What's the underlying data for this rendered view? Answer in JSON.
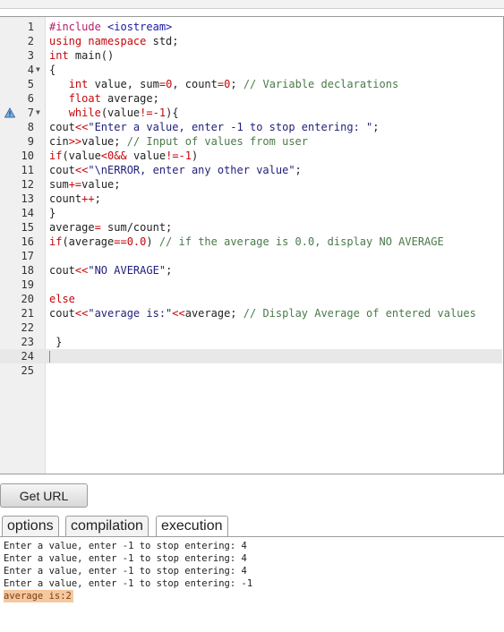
{
  "editor": {
    "lines": [
      {
        "n": "1",
        "tokens": [
          {
            "t": "#include ",
            "c": "pp"
          },
          {
            "t": "<iostream>",
            "c": "str-inc"
          }
        ]
      },
      {
        "n": "2",
        "tokens": [
          {
            "t": "using namespace ",
            "c": "kw"
          },
          {
            "t": "std;",
            "c": ""
          }
        ]
      },
      {
        "n": "3",
        "tokens": [
          {
            "t": "int ",
            "c": "ty"
          },
          {
            "t": "main()",
            "c": ""
          }
        ]
      },
      {
        "n": "4",
        "fold": true,
        "tokens": [
          {
            "t": "{",
            "c": ""
          }
        ]
      },
      {
        "n": "5",
        "tokens": [
          {
            "t": "   ",
            "c": ""
          },
          {
            "t": "int ",
            "c": "ty"
          },
          {
            "t": "value, sum",
            "c": ""
          },
          {
            "t": "=",
            "c": "op"
          },
          {
            "t": "0",
            "c": "num"
          },
          {
            "t": ", count",
            "c": ""
          },
          {
            "t": "=",
            "c": "op"
          },
          {
            "t": "0",
            "c": "num"
          },
          {
            "t": "; ",
            "c": ""
          },
          {
            "t": "// Variable declarations",
            "c": "cm"
          }
        ]
      },
      {
        "n": "6",
        "tokens": [
          {
            "t": "   ",
            "c": ""
          },
          {
            "t": "float ",
            "c": "ty"
          },
          {
            "t": "average;",
            "c": ""
          }
        ]
      },
      {
        "n": "7",
        "fold": true,
        "warn": true,
        "tokens": [
          {
            "t": "   ",
            "c": ""
          },
          {
            "t": "while",
            "c": "kw"
          },
          {
            "t": "(value",
            "c": ""
          },
          {
            "t": "!=-",
            "c": "op"
          },
          {
            "t": "1",
            "c": "num"
          },
          {
            "t": "){",
            "c": ""
          }
        ]
      },
      {
        "n": "8",
        "tokens": [
          {
            "t": "cout",
            "c": ""
          },
          {
            "t": "<<",
            "c": "op"
          },
          {
            "t": "\"Enter a value, enter -1 to stop entering: \"",
            "c": "str"
          },
          {
            "t": ";",
            "c": ""
          }
        ]
      },
      {
        "n": "9",
        "tokens": [
          {
            "t": "cin",
            "c": ""
          },
          {
            "t": ">>",
            "c": "op"
          },
          {
            "t": "value; ",
            "c": ""
          },
          {
            "t": "// Input of values from user",
            "c": "cm"
          }
        ]
      },
      {
        "n": "10",
        "tokens": [
          {
            "t": "if",
            "c": "kw"
          },
          {
            "t": "(value",
            "c": ""
          },
          {
            "t": "<",
            "c": "op"
          },
          {
            "t": "0",
            "c": "num"
          },
          {
            "t": "&&",
            "c": "op"
          },
          {
            "t": " value",
            "c": ""
          },
          {
            "t": "!=-",
            "c": "op"
          },
          {
            "t": "1",
            "c": "num"
          },
          {
            "t": ")",
            "c": ""
          }
        ]
      },
      {
        "n": "11",
        "tokens": [
          {
            "t": "cout",
            "c": ""
          },
          {
            "t": "<<",
            "c": "op"
          },
          {
            "t": "\"\\nERROR, enter any other value\"",
            "c": "str"
          },
          {
            "t": ";",
            "c": ""
          }
        ]
      },
      {
        "n": "12",
        "tokens": [
          {
            "t": "sum",
            "c": ""
          },
          {
            "t": "+=",
            "c": "op"
          },
          {
            "t": "value;",
            "c": ""
          }
        ]
      },
      {
        "n": "13",
        "tokens": [
          {
            "t": "count",
            "c": ""
          },
          {
            "t": "++",
            "c": "op"
          },
          {
            "t": ";",
            "c": ""
          }
        ]
      },
      {
        "n": "14",
        "tokens": [
          {
            "t": "}",
            "c": ""
          }
        ]
      },
      {
        "n": "15",
        "tokens": [
          {
            "t": "average",
            "c": ""
          },
          {
            "t": "=",
            "c": "op"
          },
          {
            "t": " sum/count;",
            "c": ""
          }
        ]
      },
      {
        "n": "16",
        "tokens": [
          {
            "t": "if",
            "c": "kw"
          },
          {
            "t": "(average",
            "c": ""
          },
          {
            "t": "==",
            "c": "op"
          },
          {
            "t": "0.0",
            "c": "num"
          },
          {
            "t": ") ",
            "c": ""
          },
          {
            "t": "// if the average is 0.0, display NO AVERAGE",
            "c": "cm"
          }
        ]
      },
      {
        "n": "17",
        "tokens": []
      },
      {
        "n": "18",
        "tokens": [
          {
            "t": "cout",
            "c": ""
          },
          {
            "t": "<<",
            "c": "op"
          },
          {
            "t": "\"NO AVERAGE\"",
            "c": "str"
          },
          {
            "t": ";",
            "c": ""
          }
        ]
      },
      {
        "n": "19",
        "tokens": []
      },
      {
        "n": "20",
        "tokens": [
          {
            "t": "else",
            "c": "kw"
          }
        ]
      },
      {
        "n": "21",
        "tokens": [
          {
            "t": "cout",
            "c": ""
          },
          {
            "t": "<<",
            "c": "op"
          },
          {
            "t": "\"average is:\"",
            "c": "str"
          },
          {
            "t": "<<",
            "c": "op"
          },
          {
            "t": "average; ",
            "c": ""
          },
          {
            "t": "// Display Average of entered values",
            "c": "cm"
          }
        ]
      },
      {
        "n": "22",
        "tokens": []
      },
      {
        "n": "23",
        "tokens": [
          {
            "t": " }",
            "c": ""
          }
        ]
      },
      {
        "n": "24",
        "active": true,
        "tokens": []
      },
      {
        "n": "25",
        "tokens": []
      }
    ]
  },
  "toolbar": {
    "get_url_label": "Get URL"
  },
  "tabs": [
    {
      "label": "options",
      "active": false
    },
    {
      "label": "compilation",
      "active": false
    },
    {
      "label": "execution",
      "active": true
    }
  ],
  "output": {
    "lines": [
      "Enter a value, enter -1 to stop entering: 4",
      "Enter a value, enter -1 to stop entering: 4",
      "Enter a value, enter -1 to stop entering: 4",
      "Enter a value, enter -1 to stop entering: -1"
    ],
    "result": "average is:2"
  },
  "colors": {
    "keyword": "#c5060b",
    "comment": "#4a7a4a",
    "string": "#1f1f7a",
    "result_highlight": "#f6c89e"
  }
}
